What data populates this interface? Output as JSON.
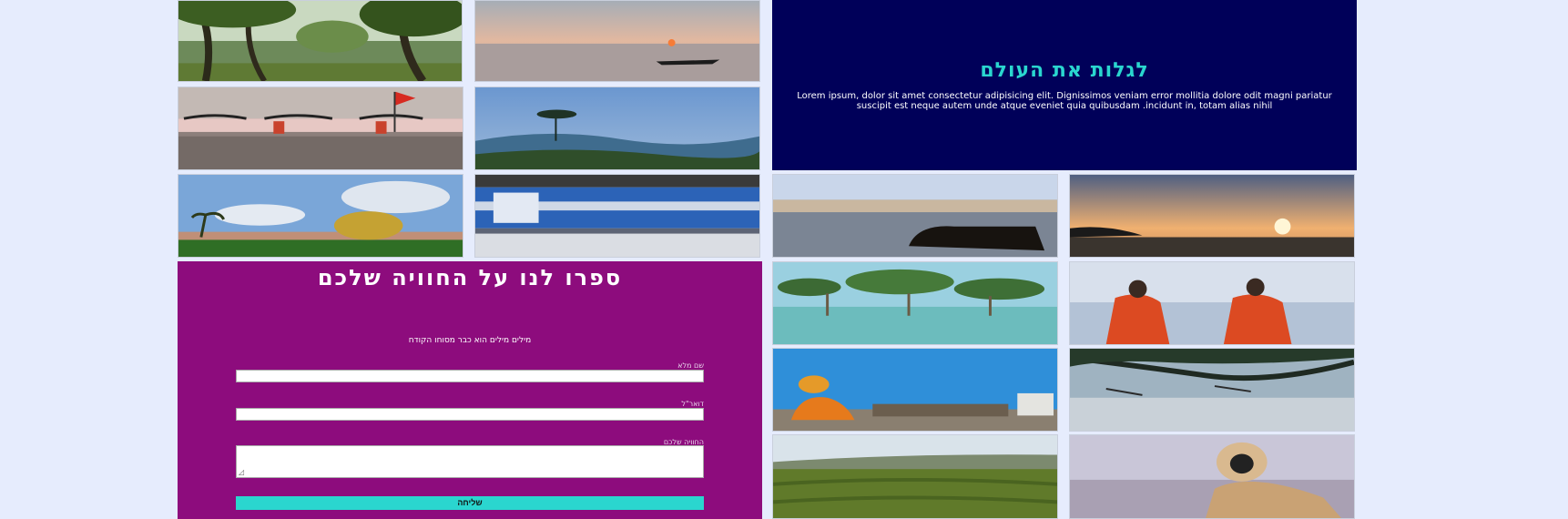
{
  "hero": {
    "title": "לגלות את העולם",
    "text": "Lorem ipsum, dolor sit amet consectetur adipisicing elit. Dignissimos veniam error mollitia dolore odit magni pariatur suscipit est neque autem unde atque eveniet quia quibusdam .incidunt in, totam alias nihil"
  },
  "form": {
    "title": "ספרו לנו על החוויה שלכם",
    "subtitle": "מילים מילים הוא כבר מסוחו הקודח",
    "name_label": "שם מלא",
    "email_label": "דואר\"ל",
    "experience_label": "החוויה שלכם",
    "submit_label": "שליחה"
  },
  "colors": {
    "page_bg": "#e6ecfd",
    "hero_bg": "#000059",
    "accent": "#2ad6cf",
    "form_bg": "#8d0c7d"
  },
  "gallery": {
    "photos": [
      "forest-trees-photo",
      "sunset-boat-photo",
      "beach-flag-photo",
      "misty-tree-photo",
      "golden-dome-photo",
      "blurred-train-photo",
      "river-cow-photo",
      "sunset-beach-photo",
      "mangrove-sea-photo",
      "monks-sea-photo",
      "sadhu-wall-photo",
      "tree-shore-photo",
      "tea-field-photo",
      "monkey-photo"
    ]
  }
}
